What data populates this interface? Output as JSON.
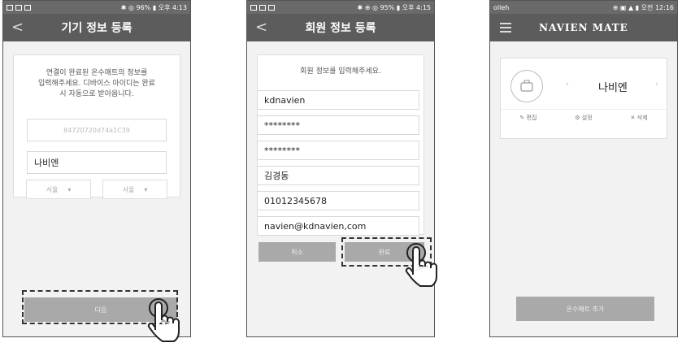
{
  "screen1": {
    "status_right": "✱ ◎ 96% ▮ 오후 4:13",
    "title": "기기 정보 등록",
    "message_lines": [
      "연결이 완료된 온수매트의 정보를",
      "입력해주세요. 디바이스 아이디는 완료",
      "시 자동으로 받아옵니다."
    ],
    "device_id": "84720720d74a1C39",
    "name_value": "나비엔",
    "region1": "서울",
    "region2": "서울",
    "next_label": "다음"
  },
  "screen2": {
    "status_right": "✱ ⊕ ◎ 95% ▮ 오후 4:15",
    "title": "회원 정보 등록",
    "message": "회원 정보를 입력해주세요.",
    "fields": [
      "kdnavien",
      "********",
      "********",
      "김경동",
      "01012345678",
      "navien@kdnavien,com"
    ],
    "cancel_label": "취소",
    "done_label": "완료"
  },
  "screen3": {
    "status_left": "olleh",
    "status_right": "⊕ ▣ ▲ ▮ 오전 12:16",
    "logo": "NAVIEN MATE",
    "device_name": "나비엔",
    "edit_label": "편집",
    "settings_label": "설정",
    "delete_label": "삭제",
    "add_label": "온수매트 추가"
  }
}
